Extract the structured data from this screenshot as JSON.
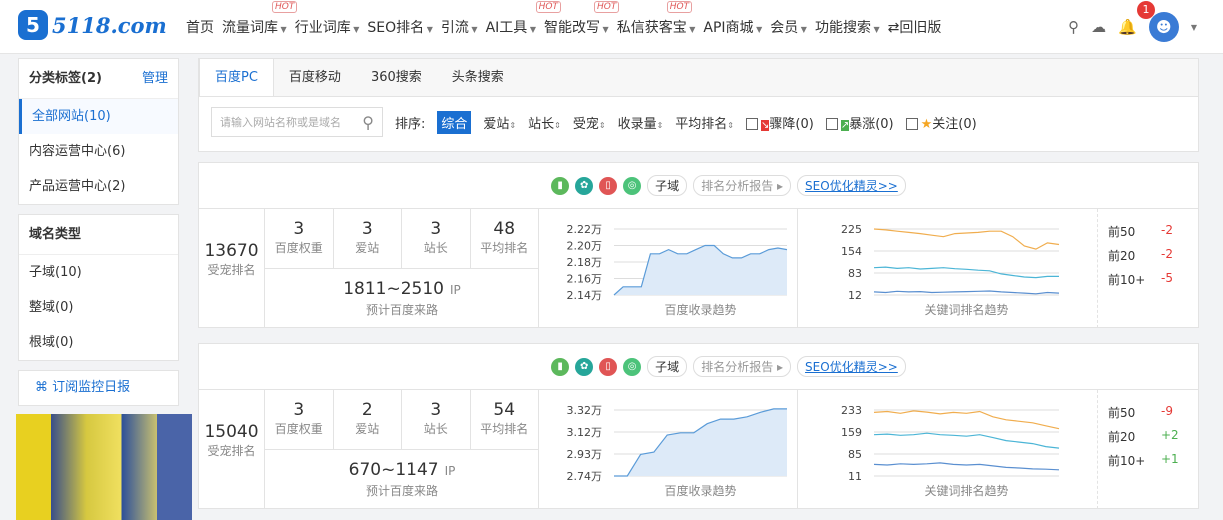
{
  "header": {
    "logo_text": "5118.com",
    "nav": [
      {
        "label": "首页"
      },
      {
        "label": "流量词库",
        "dd": true,
        "hot": true
      },
      {
        "label": "行业词库",
        "dd": true
      },
      {
        "label": "SEO排名",
        "dd": true
      },
      {
        "label": "引流",
        "dd": true
      },
      {
        "label": "AI工具",
        "dd": true,
        "hot": true
      },
      {
        "label": "智能改写",
        "dd": true,
        "hot": true
      },
      {
        "label": "私信获客宝",
        "dd": true,
        "hot": true
      },
      {
        "label": "API商城",
        "dd": true
      },
      {
        "label": "会员",
        "dd": true
      },
      {
        "label": "功能搜索",
        "dd": true
      },
      {
        "label": "⇄回旧版"
      }
    ],
    "hot_label": "HOT",
    "notif_count": "1"
  },
  "sidebar": {
    "cat_title": "分类标签(2)",
    "manage": "管理",
    "cats": [
      "全部网站(10)",
      "内容运营中心(6)",
      "产品运营中心(2)"
    ],
    "domain_title": "域名类型",
    "domains": [
      "子域(10)",
      "整域(0)",
      "根域(0)"
    ],
    "subscribe": "订阅监控日报"
  },
  "main": {
    "tabs": [
      "百度PC",
      "百度移动",
      "360搜索",
      "头条搜索"
    ],
    "search_placeholder": "请输入网站名称或是域名",
    "sort_label": "排序:",
    "sorts": [
      "综合",
      "爱站",
      "站长",
      "受宠",
      "收录量",
      "平均排名"
    ],
    "checks": [
      "骤降(0)",
      "暴涨(0)",
      "关注(0)"
    ]
  },
  "card_labels": {
    "tag": "子域",
    "report": "排名分析报告",
    "seo": "SEO优化精灵>>",
    "rank_label": "受宠排名",
    "m_labels": [
      "百度权重",
      "爱站",
      "站长",
      "平均排名"
    ],
    "ip_unit": "IP",
    "ip_label": "预计百度来路",
    "index_title": "百度收录趋势",
    "kw_title": "关键词排名趋势",
    "top_labels": [
      "前50",
      "前20",
      "前10+"
    ]
  },
  "cards": [
    {
      "rank": "13670",
      "metrics": [
        "3",
        "3",
        "3",
        "48"
      ],
      "ip": "1811~2510",
      "index_ticks": [
        "2.22万",
        "2.20万",
        "2.18万",
        "2.16万",
        "2.14万"
      ],
      "index_range": [
        2.14,
        2.22
      ],
      "index_series": [
        2.14,
        2.15,
        2.15,
        2.15,
        2.19,
        2.19,
        2.195,
        2.19,
        2.19,
        2.195,
        2.2,
        2.2,
        2.19,
        2.185,
        2.185,
        2.19,
        2.19,
        2.195,
        2.197,
        2.195
      ],
      "kw_ticks": [
        "225",
        "154",
        "83",
        "12"
      ],
      "kw_range": [
        12,
        225
      ],
      "kw_series": [
        [
          225,
          222,
          218,
          214,
          210,
          205,
          200,
          210,
          212,
          214,
          218,
          218,
          200,
          170,
          160,
          180,
          175
        ],
        [
          100,
          102,
          98,
          100,
          96,
          98,
          100,
          97,
          95,
          92,
          90,
          80,
          75,
          70,
          68,
          72,
          72
        ],
        [
          22,
          20,
          24,
          22,
          23,
          20,
          21,
          22,
          23,
          24,
          25,
          22,
          20,
          18,
          16,
          20,
          18
        ]
      ],
      "top": [
        "-2",
        "-2",
        "-5"
      ]
    },
    {
      "rank": "15040",
      "metrics": [
        "3",
        "2",
        "3",
        "54"
      ],
      "ip": "670~1147",
      "index_ticks": [
        "3.32万",
        "3.12万",
        "2.93万",
        "2.74万"
      ],
      "index_range": [
        2.74,
        3.32
      ],
      "index_series": [
        2.74,
        2.74,
        2.93,
        2.95,
        3.1,
        3.12,
        3.12,
        3.2,
        3.24,
        3.24,
        3.26,
        3.3,
        3.33,
        3.33
      ],
      "kw_ticks": [
        "233",
        "159",
        "85",
        "11"
      ],
      "kw_range": [
        11,
        233
      ],
      "kw_series": [
        [
          225,
          228,
          222,
          230,
          226,
          220,
          225,
          222,
          228,
          210,
          200,
          195,
          190,
          180,
          170
        ],
        [
          150,
          152,
          148,
          150,
          155,
          150,
          148,
          145,
          150,
          140,
          130,
          125,
          120,
          110,
          105
        ],
        [
          50,
          48,
          52,
          50,
          52,
          55,
          50,
          48,
          50,
          45,
          40,
          38,
          35,
          34,
          32
        ]
      ],
      "top": [
        "-9",
        "+2",
        "+1"
      ]
    }
  ]
}
